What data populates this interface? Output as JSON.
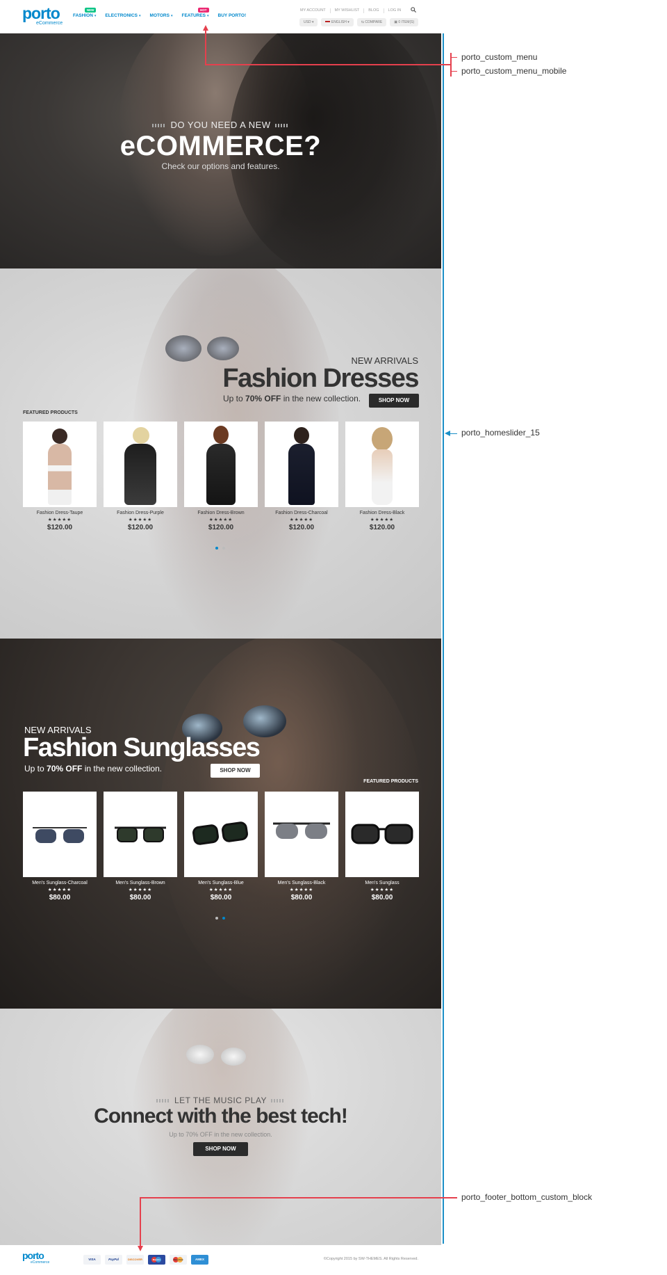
{
  "header": {
    "logo": "porto",
    "logo_sub": "eCommerce",
    "nav": [
      {
        "label": "FASHION",
        "badge": "NEW",
        "badge_color": "#0cc485"
      },
      {
        "label": "ELECTRONICS",
        "badge": "",
        "badge_color": ""
      },
      {
        "label": "MOTORS",
        "badge": "",
        "badge_color": ""
      },
      {
        "label": "FEATURES",
        "badge": "HOT",
        "badge_color": "#eb2771"
      },
      {
        "label": "BUY PORTO!",
        "badge": "",
        "badge_color": ""
      }
    ],
    "top_links": [
      "MY ACCOUNT",
      "MY WISHLIST",
      "BLOG",
      "LOG IN"
    ],
    "currency": "USD",
    "language": "ENGLISH",
    "compare": "COMPARE",
    "cart": "0 ITEM(S)"
  },
  "slide1": {
    "small": "DO YOU NEED A NEW",
    "big": "eCOMMERCE?",
    "sub": "Check our options and features."
  },
  "slide2": {
    "new": "NEW ARRIVALS",
    "big": "Fashion Dresses",
    "sub_pre": "Up to ",
    "sub_bold": "70% OFF",
    "sub_post": " in the new collection.",
    "button": "SHOP NOW",
    "featured": "FEATURED PRODUCTS",
    "products": [
      {
        "name": "Fashion Dress-Taupe",
        "stars": "★★★★★",
        "price": "$120.00"
      },
      {
        "name": "Fashion Dress-Purple",
        "stars": "★★★★★",
        "price": "$120.00"
      },
      {
        "name": "Fashion Dress-Brown",
        "stars": "★★★★★",
        "price": "$120.00"
      },
      {
        "name": "Fashion Dress-Charcoal",
        "stars": "★★★★★",
        "price": "$120.00"
      },
      {
        "name": "Fashion Dress-Black",
        "stars": "★★★★★",
        "price": "$120.00"
      }
    ]
  },
  "slide3": {
    "new": "NEW ARRIVALS",
    "big": "Fashion Sunglasses",
    "sub_pre": "Up to ",
    "sub_bold": "70% OFF",
    "sub_post": " in the new collection.",
    "button": "SHOP NOW",
    "featured": "FEATURED PRODUCTS",
    "products": [
      {
        "name": "Men's Sunglass-Charcoal",
        "stars": "★★★★★",
        "price": "$80.00"
      },
      {
        "name": "Men's Sunglass-Brown",
        "stars": "★★★★★",
        "price": "$80.00"
      },
      {
        "name": "Men's Sunglass-Blue",
        "stars": "★★★★★",
        "price": "$80.00"
      },
      {
        "name": "Men's Sunglass-Black",
        "stars": "★★★★★",
        "price": "$80.00"
      },
      {
        "name": "Men's Sunglass",
        "stars": "★★★★★",
        "price": "$80.00"
      }
    ]
  },
  "slide4": {
    "small": "LET THE MUSIC PLAY",
    "big": "Connect with the best tech!",
    "sub": "Up to 70% OFF in the new collection.",
    "button": "SHOP NOW"
  },
  "footer": {
    "logo": "porto",
    "logo_sub": "eCommerce",
    "cards": [
      "VISA",
      "PayPal",
      "DISCOVER",
      "Maestro",
      "MasterCard",
      "AMEX"
    ],
    "copyright": "©Copyright 2015 by SW-THEMES. All Rights Reserved."
  },
  "annotations": {
    "menu": "porto_custom_menu",
    "menu_mobile": "porto_custom_menu_mobile",
    "homeslider": "porto_homeslider_15",
    "footer_block": "porto_footer_bottom_custom_block"
  },
  "colors": {
    "brand": "#0088cc",
    "annotation_red": "#e5404d",
    "annotation_blue": "#1c8fc6",
    "dark_button": "#2b2b2b"
  }
}
